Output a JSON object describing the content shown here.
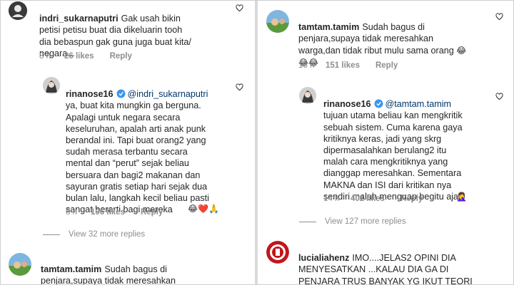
{
  "left": {
    "c1": {
      "username": "indri_sukarnaputri",
      "text": "Gak usah bikin\npetisi petisu buat dia dikeluarin tooh\ndia bebaspun gak guna juga buat kita/\nnegara...",
      "time": "8 h",
      "likes": "26 likes",
      "reply": "Reply"
    },
    "c2": {
      "username": "rinanose16",
      "mention": "@indri_sukarnaputri",
      "text": "ya, buat kita mungkin ga berguna.\nApalagi untuk negara secara\nkeseluruhan, apalah arti anak punk\nberandal ini. Tapi buat orang2 yang\nsudah merasa terbantu secara\nmental dan “perut” sejak beliau\nbersuara dan bagi2 makanan dan\nsayuran gratis setiap hari sejak dua\nbulan lalu, langkah kecil beliau pasti\nsangat berarti bagi mereka",
      "emojis": "😂❤️🙏",
      "time": "8 h",
      "likes": "106 likes",
      "reply": "Reply"
    },
    "view_more": "View 32 more replies",
    "c3": {
      "username": "tamtam.tamim",
      "text": "Sudah bagus di\npenjara,supaya tidak meresahkan\nwarga,dan tidak ribut mulu sama orang",
      "emojis": "😂"
    }
  },
  "right": {
    "c1": {
      "username": "tamtam.tamim",
      "text": "Sudah bagus di\npenjara,supaya tidak meresahkan\nwarga,dan tidak ribut mulu sama orang",
      "emojis1": "😂",
      "emojis2": "😂😂",
      "time": "16 h",
      "likes": "151 likes",
      "reply": "Reply"
    },
    "c2": {
      "username": "rinanose16",
      "mention": "@tamtam.tamim",
      "text": "tujuan utama beliau kan mengkritik\nsebuah sistem. Cuma karena gaya\nkritiknya keras, jadi yang skrg\ndipermasalahkan berulang2 itu\nmalah cara mengkritiknya yang\ndianggap meresahkan. Sementara\nMAKNA dan ISI dari kritikan nya\nsendiri malah menguap begitu aja",
      "emojis": "🤦‍♀️",
      "time": "14 h",
      "likes": "402 likes",
      "reply": "Reply"
    },
    "view_more": "View 127 more replies",
    "c3": {
      "username": "lucialiahenz",
      "text": "IMO....JELAS2 OPINI DIA\nMENYESATKAN ...KALAU DIA GA DI\nPENJARA TRUS BANYAK YG IKUT TEORI\nKONSPIRASI DIA YG BAHAYA YA KITA"
    }
  },
  "colors": {
    "text": "#262626",
    "meta": "#8e8e8e",
    "mention": "#00376b",
    "verified": "#3897f0"
  }
}
